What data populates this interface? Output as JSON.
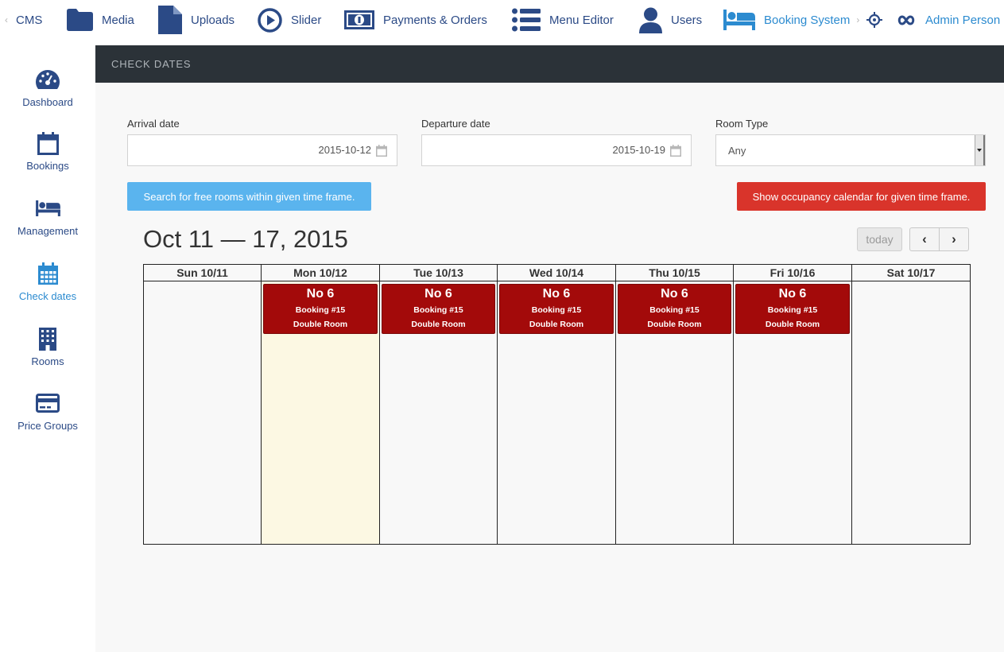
{
  "nav": {
    "back": "‹",
    "items": [
      {
        "label": "CMS",
        "icon": "back-chevron-icon"
      },
      {
        "label": "Media",
        "icon": "folder-icon"
      },
      {
        "label": "Uploads",
        "icon": "file-icon"
      },
      {
        "label": "Slider",
        "icon": "play-circle-icon"
      },
      {
        "label": "Payments & Orders",
        "icon": "banknote-icon"
      },
      {
        "label": "Menu Editor",
        "icon": "list-icon"
      },
      {
        "label": "Users",
        "icon": "user-icon"
      },
      {
        "label": "Booking System",
        "icon": "bed-icon",
        "active": true
      },
      {
        "label": "",
        "icon": "crosshair-icon"
      },
      {
        "label": "Admin Person",
        "icon": "infinity-icon"
      }
    ],
    "separator": "›"
  },
  "sidebar": {
    "items": [
      {
        "label": "Dashboard",
        "icon": "dashboard-icon"
      },
      {
        "label": "Bookings",
        "icon": "calendar-icon"
      },
      {
        "label": "Management",
        "icon": "bed-icon"
      },
      {
        "label": "Check dates",
        "icon": "calendar-grid-icon",
        "active": true
      },
      {
        "label": "Rooms",
        "icon": "building-icon"
      },
      {
        "label": "Price Groups",
        "icon": "credit-card-icon"
      }
    ]
  },
  "header": {
    "title": "CHECK DATES"
  },
  "form": {
    "arrival_label": "Arrival date",
    "arrival_value": "2015-10-12",
    "departure_label": "Departure date",
    "departure_value": "2015-10-19",
    "room_type_label": "Room Type",
    "room_type_value": "Any"
  },
  "buttons": {
    "search": "Search for free rooms within given time frame.",
    "occupancy": "Show occupancy calendar for given time frame."
  },
  "calendar": {
    "title": "Oct 11 — 17, 2015",
    "today": "today",
    "prev": "‹",
    "next": "›",
    "days": [
      {
        "label": "Sun 10/11"
      },
      {
        "label": "Mon 10/12",
        "today": true
      },
      {
        "label": "Tue 10/13"
      },
      {
        "label": "Wed 10/14"
      },
      {
        "label": "Thu 10/15"
      },
      {
        "label": "Fri 10/16"
      },
      {
        "label": "Sat 10/17"
      }
    ],
    "events": [
      {
        "day": 1,
        "title": "No 6",
        "booking": "Booking #15",
        "room": "Double Room"
      },
      {
        "day": 2,
        "title": "No 6",
        "booking": "Booking #15",
        "room": "Double Room"
      },
      {
        "day": 3,
        "title": "No 6",
        "booking": "Booking #15",
        "room": "Double Room"
      },
      {
        "day": 4,
        "title": "No 6",
        "booking": "Booking #15",
        "room": "Double Room"
      },
      {
        "day": 5,
        "title": "No 6",
        "booking": "Booking #15",
        "room": "Double Room"
      }
    ]
  },
  "colors": {
    "nav_text": "#2b4a86",
    "active": "#2c8bd0",
    "header_bg": "#2b3238",
    "event_bg": "#a30a0a",
    "search_btn": "#5ab4ee",
    "occupancy_btn": "#d9342b",
    "today_bg": "#fcf8e3"
  }
}
